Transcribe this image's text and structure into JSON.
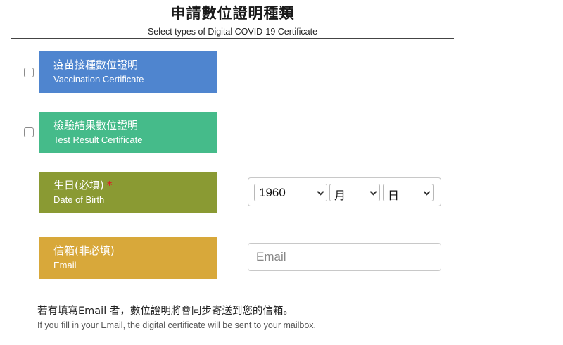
{
  "header": {
    "title_zh": "申請數位證明種類",
    "title_en": "Select types of Digital COVID-19 Certificate"
  },
  "options": {
    "vaccination": {
      "label_zh": "疫苗接種數位證明",
      "label_en": "Vaccination Certificate",
      "color": "#4f85cf",
      "checked": false
    },
    "test_result": {
      "label_zh": "檢驗結果數位證明",
      "label_en": "Test Result Certificate",
      "color": "#45bb8a",
      "checked": false
    }
  },
  "dob": {
    "label_zh": "生日(必填)",
    "required_mark": "*",
    "label_en": "Date of Birth",
    "color": "#8a9a33",
    "year": "1960",
    "month": "月",
    "day": "日"
  },
  "email": {
    "label_zh": "信箱(非必填)",
    "label_en": "Email",
    "color": "#d8a83a",
    "placeholder": "Email",
    "value": ""
  },
  "note": {
    "zh": "若有填寫Email 者，數位證明將會同步寄送到您的信箱。",
    "en": "If you fill in your Email, the digital certificate will be sent to your mailbox."
  }
}
